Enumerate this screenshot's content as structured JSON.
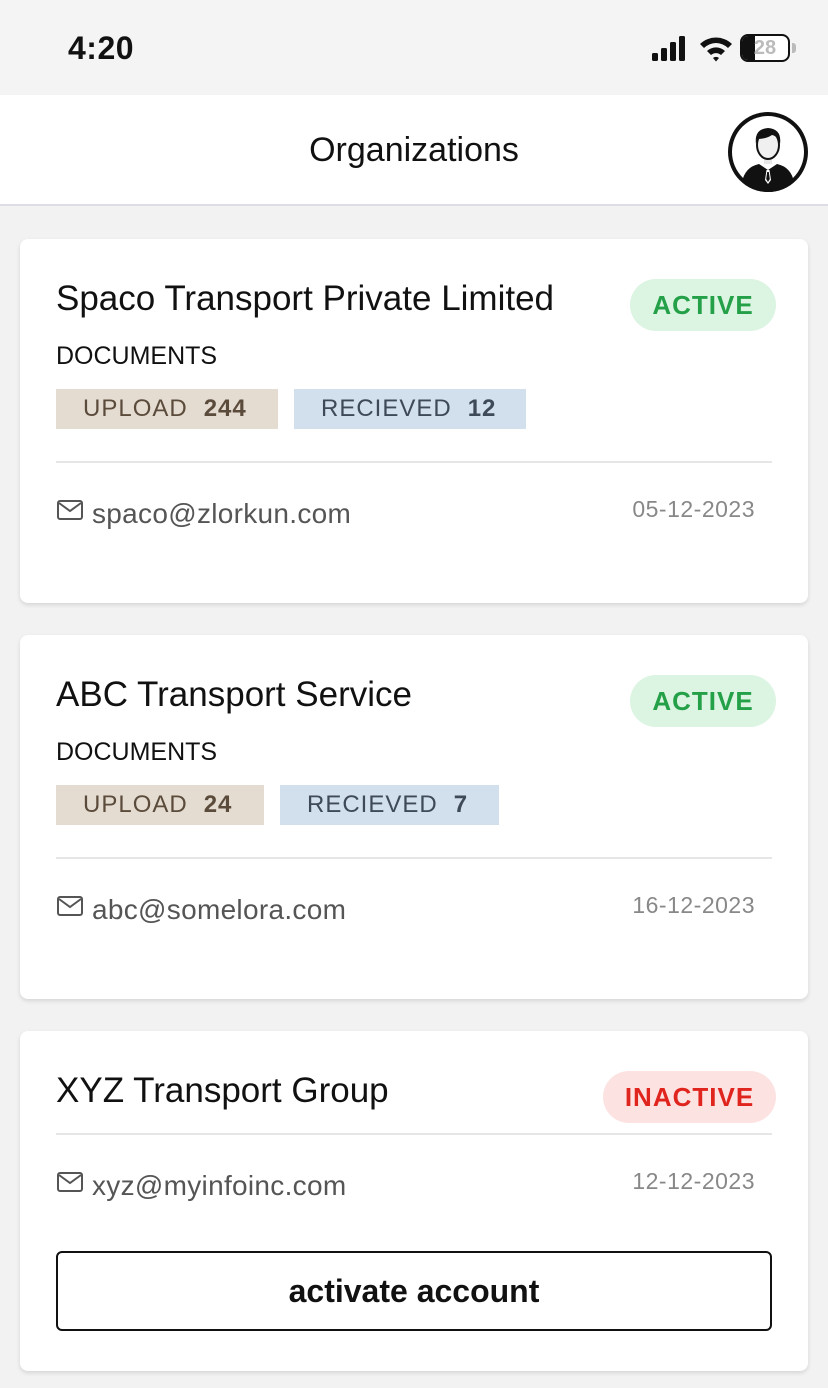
{
  "status_bar": {
    "time": "4:20",
    "battery": "28",
    "battery_level": 0.28,
    "icons": [
      "signal-icon",
      "wifi-icon",
      "battery-icon"
    ]
  },
  "header": {
    "title": "Organizations",
    "avatar_icon": "user-avatar-icon"
  },
  "organizations": [
    {
      "name": "Spaco Transport Private Limited",
      "status": "ACTIVE",
      "documents_label": "DOCUMENTS",
      "upload_label": "UPLOAD",
      "upload_count": "244",
      "received_label": "RECIEVED",
      "received_count": "12",
      "email": "spaco@zlorkun.com",
      "date": "05-12-2023"
    },
    {
      "name": "ABC Transport Service",
      "status": "ACTIVE",
      "documents_label": "DOCUMENTS",
      "upload_label": "UPLOAD",
      "upload_count": "24",
      "received_label": "RECIEVED",
      "received_count": "7",
      "email": "abc@somelora.com",
      "date": "16-12-2023"
    },
    {
      "name": "XYZ Transport Group",
      "status": "INACTIVE",
      "email": "xyz@myinfoinc.com",
      "date": "12-12-2023",
      "action_label": "activate account"
    }
  ],
  "colors": {
    "active_text": "#24a148",
    "active_bg": "#dcf4e2",
    "inactive_text": "#e0251e",
    "inactive_bg": "#fde2e2",
    "upload_bg": "#e4dbd1",
    "received_bg": "#d2dfec"
  }
}
